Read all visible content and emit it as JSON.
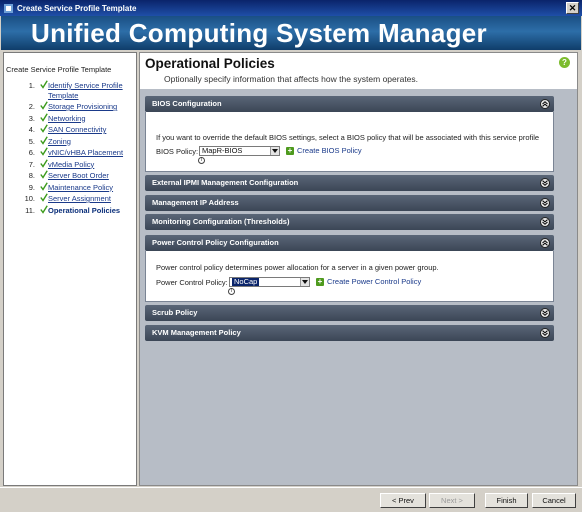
{
  "window": {
    "title": "Create Service Profile Template",
    "close_glyph": "✕"
  },
  "banner": {
    "title": "Unified Computing System Manager"
  },
  "left_panel": {
    "title": "Create Service Profile Template",
    "steps": [
      {
        "num": "1.",
        "label": "Identify Service Profile Template",
        "checked": true
      },
      {
        "num": "2.",
        "label": "Storage Provisioning",
        "checked": true
      },
      {
        "num": "3.",
        "label": "Networking",
        "checked": true
      },
      {
        "num": "4.",
        "label": "SAN Connectivity",
        "checked": true
      },
      {
        "num": "5.",
        "label": "Zoning",
        "checked": true
      },
      {
        "num": "6.",
        "label": "vNIC/vHBA Placement",
        "checked": true
      },
      {
        "num": "7.",
        "label": "vMedia Policy",
        "checked": true
      },
      {
        "num": "8.",
        "label": "Server Boot Order",
        "checked": true
      },
      {
        "num": "9.",
        "label": "Maintenance Policy",
        "checked": true
      },
      {
        "num": "10.",
        "label": "Server Assignment",
        "checked": true
      },
      {
        "num": "11.",
        "label": "Operational Policies",
        "checked": true,
        "active": true
      }
    ]
  },
  "main": {
    "title": "Operational Policies",
    "subtitle": "Optionally specify information that affects how the system operates.",
    "help_glyph": "?",
    "sections": {
      "bios": {
        "title": "BIOS Configuration",
        "description": "If you want to override the default BIOS settings, select a BIOS policy that will be associated with this service profile",
        "field_label": "BIOS Policy:",
        "value": "MapR-BIOS",
        "create_link": "Create BIOS Policy"
      },
      "ipmi": {
        "title": "External IPMI Management Configuration"
      },
      "mgmt_ip": {
        "title": "Management IP Address"
      },
      "monitoring": {
        "title": "Monitoring Configuration (Thresholds)"
      },
      "power": {
        "title": "Power Control Policy Configuration",
        "description": "Power control policy determines power allocation for a server in a given power group.",
        "field_label": "Power Control Policy:",
        "value": "NoCap",
        "create_link": "Create Power Control Policy"
      },
      "scrub": {
        "title": "Scrub Policy"
      },
      "kvm": {
        "title": "KVM Management Policy"
      }
    },
    "info_glyph": "i",
    "plus_glyph": "+"
  },
  "footer": {
    "prev": "< Prev",
    "next": "Next >",
    "finish": "Finish",
    "cancel": "Cancel"
  },
  "colors": {
    "section_header": "#4a5566",
    "banner": "#2d6ea8",
    "content_bg": "#b7bdc6",
    "checkmark": "#3a9a1a"
  }
}
